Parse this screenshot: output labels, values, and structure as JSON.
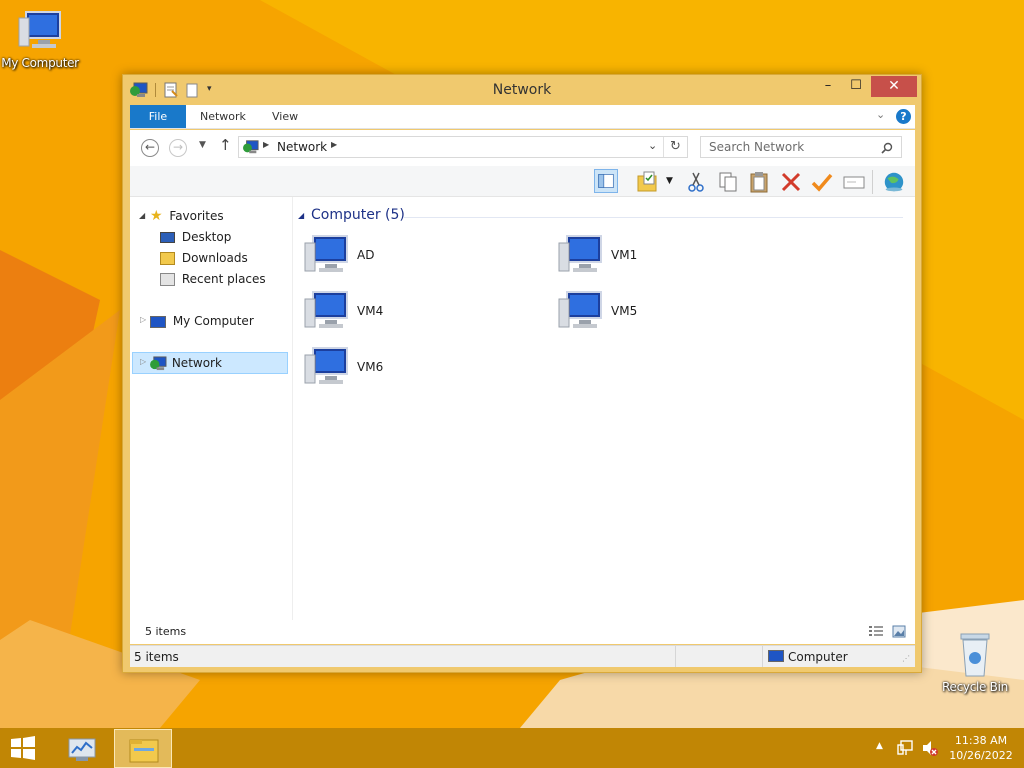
{
  "desktop": {
    "icons": [
      {
        "label": "My Computer"
      },
      {
        "label": "Recycle Bin"
      }
    ]
  },
  "window": {
    "title": "Network",
    "controls": {
      "minimize": "–",
      "maximize": "☐",
      "close": "✕"
    },
    "ribbon_tabs": [
      "File",
      "Network",
      "View"
    ],
    "address": {
      "path": "Network"
    },
    "search": {
      "placeholder": "Search Network"
    },
    "nav_pane": {
      "favorites_label": "Favorites",
      "favorites": [
        "Desktop",
        "Downloads",
        "Recent places"
      ],
      "my_computer": "My Computer",
      "network": "Network"
    },
    "content": {
      "group_header": "Computer (5)",
      "computers": [
        "AD",
        "VM1",
        "VM4",
        "VM5",
        "VM6"
      ]
    },
    "inner_status": "5 items",
    "status_bar": {
      "left": "5 items",
      "right": "Computer"
    }
  },
  "taskbar": {
    "clock_time": "11:38 AM",
    "clock_date": "10/26/2022"
  },
  "colors": {
    "accent": "#1979ca",
    "desktop": "#f6a400",
    "window_frame": "#f0c96e",
    "close_button": "#c7504a",
    "selection": "#cce8ff"
  }
}
